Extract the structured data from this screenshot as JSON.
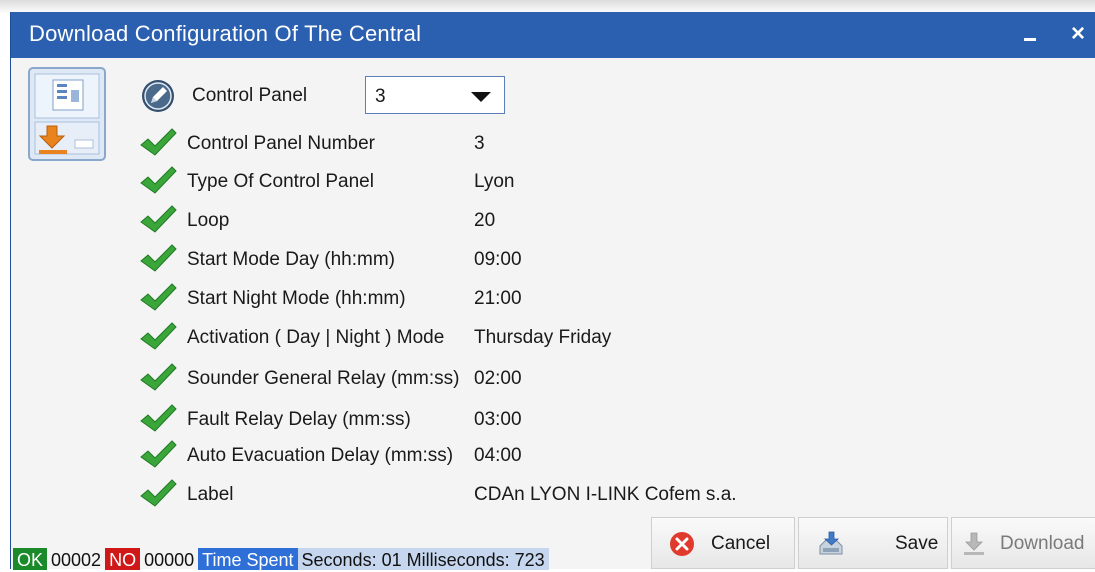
{
  "window": {
    "title": "Download Configuration Of The Central",
    "minimize_icon": "minimize-icon",
    "close_label": "×"
  },
  "panel_select": {
    "label": "Control Panel",
    "value": "3"
  },
  "rows": [
    {
      "label": "Control Panel Number",
      "value": "3"
    },
    {
      "label": "Type Of Control Panel",
      "value": "Lyon"
    },
    {
      "label": "Loop",
      "value": "20"
    },
    {
      "label": "Start Mode Day (hh:mm)",
      "value": "09:00"
    },
    {
      "label": "Start Night Mode (hh:mm)",
      "value": "21:00"
    },
    {
      "label": "Activation ( Day | Night ) Mode",
      "value": "Thursday Friday"
    },
    {
      "label": "Sounder General Relay (mm:ss)",
      "value": "02:00"
    },
    {
      "label": "Fault Relay Delay (mm:ss)",
      "value": "03:00"
    },
    {
      "label": "Auto Evacuation Delay (mm:ss)",
      "value": "04:00"
    },
    {
      "label": "Label",
      "value": "CDAn LYON I-LINK Cofem s.a."
    }
  ],
  "status": {
    "ok_label": "OK",
    "ok_count": "00002",
    "no_label": "NO",
    "no_count": "00000",
    "time_label": "Time Spent",
    "time_value": "Seconds: 01 Milliseconds: 723"
  },
  "buttons": {
    "cancel": "Cancel",
    "save": "Save",
    "download": "Download"
  },
  "colors": {
    "titlebar": "#2b60b0",
    "check": "#3aa63a",
    "ok": "#1a8a2a",
    "no": "#d01818",
    "time": "#2f6fd8"
  }
}
